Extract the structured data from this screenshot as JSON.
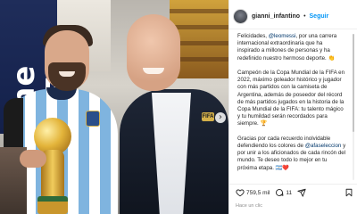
{
  "photo": {
    "banner_text": "The FIFA",
    "pin_label": "FIFA",
    "next_arrow": "›"
  },
  "header": {
    "username": "gianni_infantino",
    "separator": "•",
    "follow_label": "Seguir"
  },
  "caption": {
    "p1_before": "Felicidades, ",
    "p1_mention": "@leomessi",
    "p1_after": ", por una carrera internacional extraordinaria que ha inspirado a millones de personas y ha redefinido nuestro hermoso deporte. 👏",
    "p2": "Campeón de la Copa Mundial de la FIFA en 2022, máximo goleador histórico y jugador con más partidos con la camiseta de Argentina, además de poseedor del récord de más partidos jugados en la historia de la Copa Mundial de la FIFA: tu talento mágico y tu humildad serán recordados para siempre. 🏆",
    "p3_before": "Gracias por cada recuerdo inolvidable defendiendo los colores de ",
    "p3_mention": "@afaseleccion",
    "p3_after": " y por unir a los aficionados de cada rincón del mundo. Te deseo todo lo mejor en tu próxima etapa. 🇦🇷❤️"
  },
  "actions": {
    "likes_count": "759,5 mil",
    "comments_count": "11"
  },
  "comment_box": {
    "placeholder": "Hace un clic"
  },
  "icons": [
    "like-icon",
    "comment-icon",
    "share-icon",
    "save-icon",
    "chevron-right-icon"
  ]
}
